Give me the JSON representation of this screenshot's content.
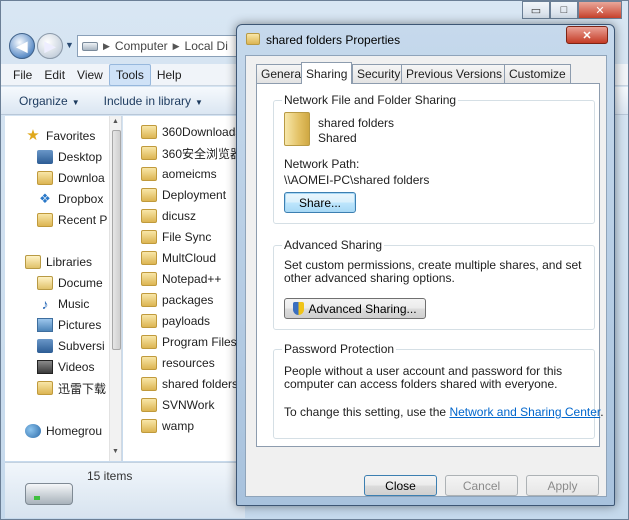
{
  "explorer": {
    "window_controls": {
      "minimize": "▭",
      "maximize": "□",
      "close": "✕"
    },
    "nav": {
      "back": "◀",
      "forward": "▶",
      "history": "▼"
    },
    "breadcrumb": [
      "Computer",
      "Local Di"
    ],
    "menu": [
      "File",
      "Edit",
      "View",
      "Tools",
      "Help"
    ],
    "toolbar": {
      "organize": "Organize",
      "include_in_library": "Include in library"
    },
    "navigation_pane": {
      "favorites_header": "Favorites",
      "favorites": [
        "Desktop",
        "Downloa",
        "Dropbox",
        "Recent P"
      ],
      "libraries_header": "Libraries",
      "libraries": [
        "Docume",
        "Music",
        "Pictures",
        "Subversi",
        "Videos",
        "迅雷下载"
      ],
      "homegroup": "Homegrou"
    },
    "files": [
      "360Downloads",
      "360安全浏览器",
      "aomeicms",
      "Deployment",
      "dicusz",
      "File Sync",
      "MultCloud",
      "Notepad++",
      "packages",
      "payloads",
      "Program Files (",
      "resources",
      "shared folders",
      "SVNWork",
      "wamp"
    ],
    "status": {
      "item_count": "15 items"
    }
  },
  "dialog": {
    "title": "shared folders Properties",
    "close_glyph": "✕",
    "tabs": [
      "General",
      "Sharing",
      "Security",
      "Previous Versions",
      "Customize"
    ],
    "active_tab": "Sharing",
    "network_sharing": {
      "heading": "Network File and Folder Sharing",
      "folder_name": "shared folders",
      "folder_state": "Shared",
      "path_label": "Network Path:",
      "path_value": "\\\\AOMEI-PC\\shared folders",
      "share_button": "Share..."
    },
    "advanced_sharing": {
      "heading": "Advanced Sharing",
      "description": "Set custom permissions, create multiple shares, and set other advanced sharing options.",
      "button": "Advanced Sharing..."
    },
    "password_protection": {
      "heading": "Password Protection",
      "description": "People without a user account and password for this computer can access folders shared with everyone.",
      "change_prefix": "To change this setting, use the",
      "link": "Network and Sharing Center",
      "change_suffix": "."
    },
    "buttons": {
      "close": "Close",
      "cancel": "Cancel",
      "apply": "Apply"
    }
  }
}
